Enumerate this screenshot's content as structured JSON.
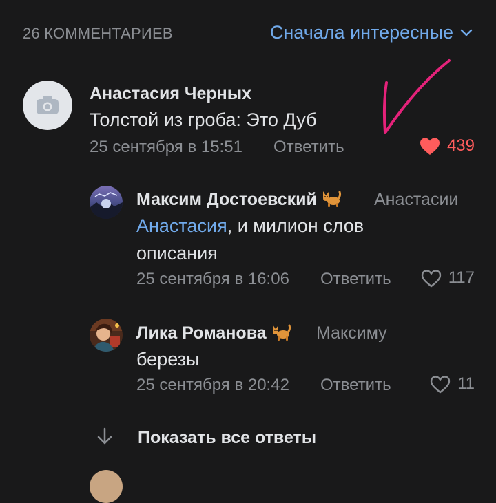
{
  "header": {
    "comments_count": "26 КОММЕНТАРИЕВ",
    "sort_label": "Сначала интересные"
  },
  "comments": [
    {
      "author": "Анастасия Черных",
      "text": "Толстой из гроба: Это Дуб",
      "date": "25 сентября в 15:51",
      "reply_label": "Ответить",
      "likes": "439",
      "liked": true,
      "avatar_icon": "camera-placeholder-icon"
    }
  ],
  "replies": [
    {
      "author": "Максим Достоевский",
      "author_emoji": "🐈",
      "reply_to": "Анастасии",
      "mention": "Анастасия",
      "text": ", и милион слов описания",
      "date": "25 сентября в 16:06",
      "reply_label": "Ответить",
      "likes": "117",
      "liked": false
    },
    {
      "author": "Лика Романова",
      "author_emoji": "🐈",
      "reply_to": "Максиму",
      "text": "березы",
      "date": "25 сентября в 20:42",
      "reply_label": "Ответить",
      "likes": "11",
      "liked": false
    }
  ],
  "show_all_label": "Показать все ответы",
  "colors": {
    "background": "#19191a",
    "accent": "#71aaeb",
    "like_active": "#ff5c5c",
    "secondary_text": "#8b8e93",
    "annotation_stroke": "#e5227a"
  }
}
